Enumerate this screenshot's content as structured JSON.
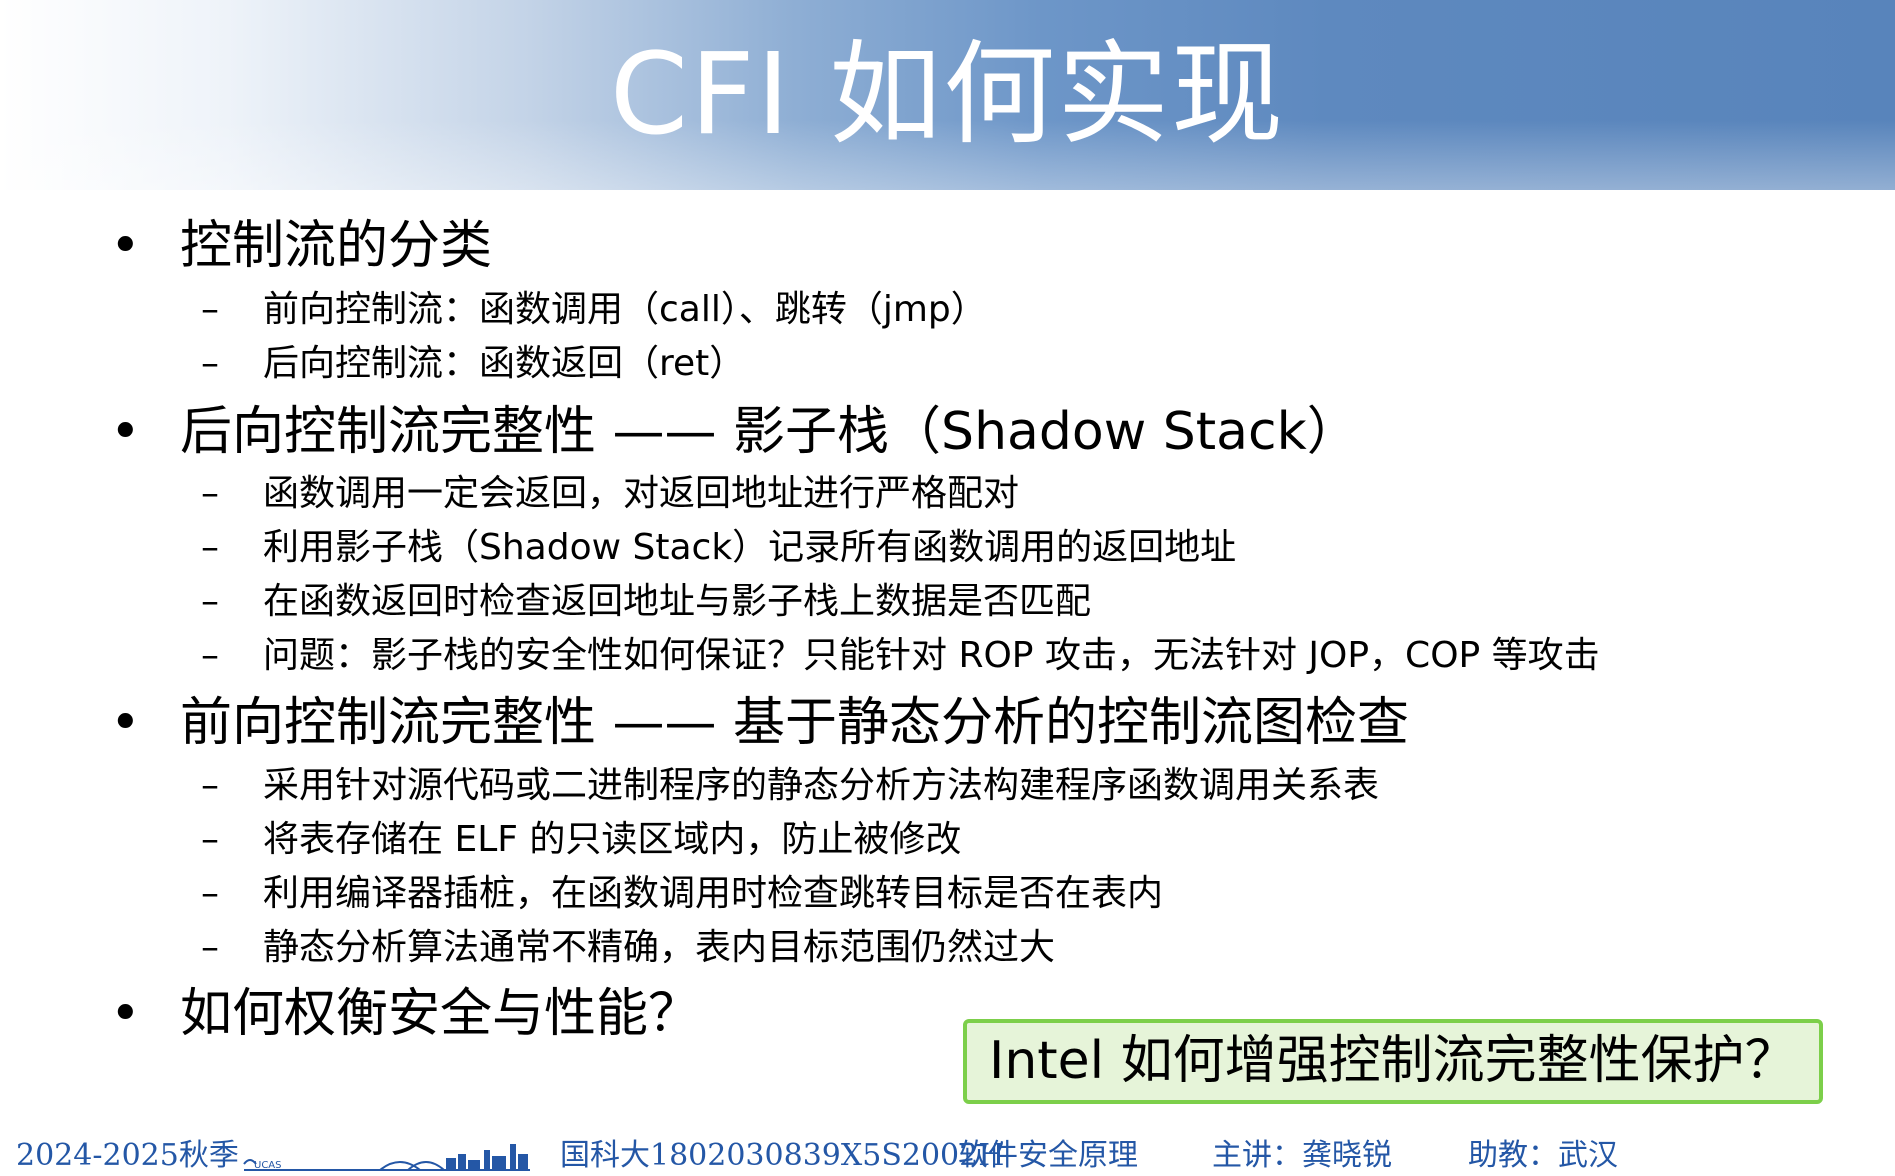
{
  "slide": {
    "title": "CFI 如何实现",
    "bullets": [
      {
        "marker": "•",
        "text": "控制流的分类",
        "subs": [
          {
            "marker": "–",
            "text": "前向控制流：函数调用（call）、跳转（jmp）"
          },
          {
            "marker": "–",
            "text": "后向控制流：函数返回（ret）"
          }
        ]
      },
      {
        "marker": "•",
        "text": "后向控制流完整性 —— 影子栈（Shadow Stack）",
        "subs": [
          {
            "marker": "–",
            "text": "函数调用一定会返回，对返回地址进行严格配对"
          },
          {
            "marker": "–",
            "text": "利用影子栈（Shadow Stack）记录所有函数调用的返回地址"
          },
          {
            "marker": "–",
            "text": "在函数返回时检查返回地址与影子栈上数据是否匹配"
          },
          {
            "marker": "–",
            "text": "问题：影子栈的安全性如何保证？只能针对 ROP 攻击，无法针对 JOP，COP 等攻击"
          }
        ]
      },
      {
        "marker": "•",
        "text": "前向控制流完整性 —— 基于静态分析的控制流图检查",
        "subs": [
          {
            "marker": "–",
            "text": "采用针对源代码或二进制程序的静态分析方法构建程序函数调用关系表"
          },
          {
            "marker": "–",
            "text": "将表存储在 ELF 的只读区域内，防止被修改"
          },
          {
            "marker": "–",
            "text": "利用编译器插桩，在函数调用时检查跳转目标是否在表内"
          },
          {
            "marker": "–",
            "text": "静态分析算法通常不精确，表内目标范围仍然过大"
          }
        ]
      },
      {
        "marker": "•",
        "text": "如何权衡安全与性能？",
        "subs": []
      }
    ],
    "callout": "Intel 如何增强控制流完整性保护？"
  },
  "footer": {
    "semester": "2024-2025秋季",
    "logo_text": "UCAS",
    "course_code": "国科大1802030839X5S2002H",
    "course_name": "软件安全原理",
    "lecturer": "主讲：龚晓锐",
    "assistant": "助教：武汉"
  },
  "colors": {
    "header_blue": "#5884bb",
    "footer_text": "#2457a6",
    "callout_border": "#7ccf4a",
    "callout_fill": "#e6f4d9"
  }
}
